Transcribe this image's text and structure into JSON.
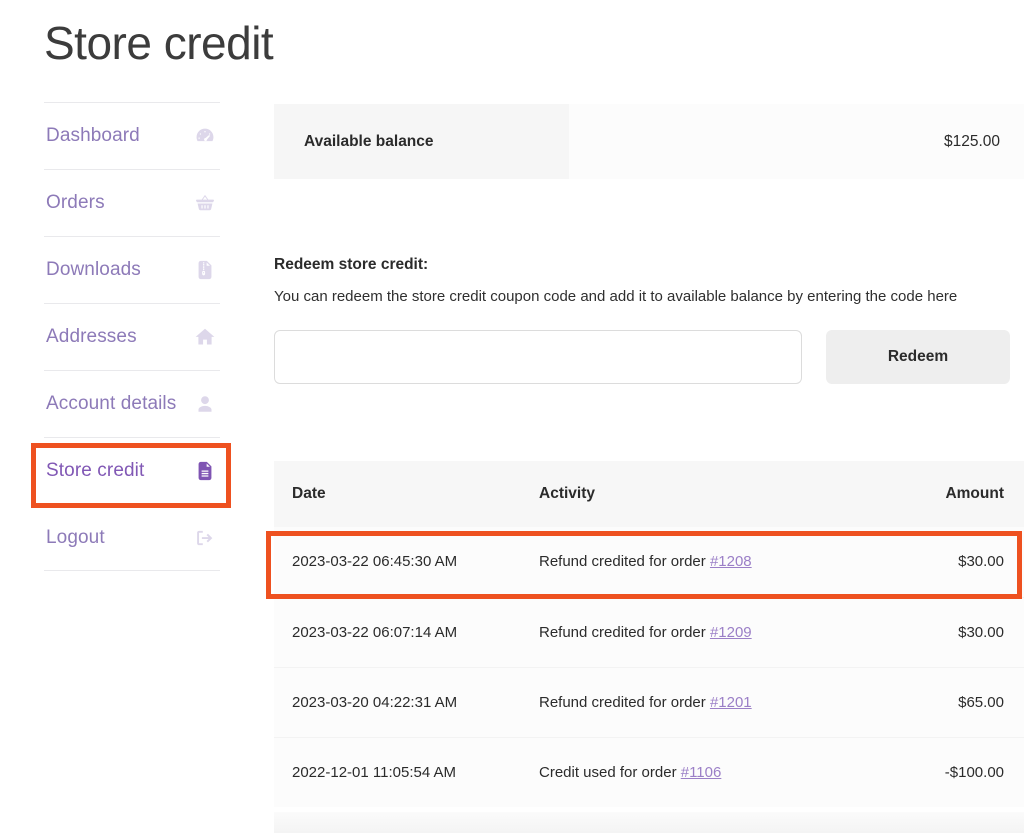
{
  "page": {
    "title": "Store credit"
  },
  "sidebar": {
    "items": [
      {
        "label": "Dashboard",
        "icon": "gauge-icon",
        "active": false
      },
      {
        "label": "Orders",
        "icon": "basket-icon",
        "active": false
      },
      {
        "label": "Downloads",
        "icon": "download-file-icon",
        "active": false
      },
      {
        "label": "Addresses",
        "icon": "home-icon",
        "active": false
      },
      {
        "label": "Account details",
        "icon": "user-icon",
        "active": false
      },
      {
        "label": "Store credit",
        "icon": "document-icon",
        "active": true
      },
      {
        "label": "Logout",
        "icon": "logout-icon",
        "active": false
      }
    ]
  },
  "balance": {
    "label": "Available balance",
    "value": "$125.00"
  },
  "redeem": {
    "heading": "Redeem store credit:",
    "description": "You can redeem the store credit coupon code and add it to available balance by entering the code here",
    "input_value": "",
    "input_placeholder": "",
    "button_label": "Redeem"
  },
  "activity": {
    "columns": [
      "Date",
      "Activity",
      "Amount"
    ],
    "rows": [
      {
        "date": "2023-03-22 06:45:30 AM",
        "activity_prefix": "Refund credited for order ",
        "order_link": "#1208",
        "amount": "$30.00",
        "highlighted": true
      },
      {
        "date": "2023-03-22 06:07:14 AM",
        "activity_prefix": "Refund credited for order ",
        "order_link": "#1209",
        "amount": "$30.00",
        "highlighted": false
      },
      {
        "date": "2023-03-20 04:22:31 AM",
        "activity_prefix": "Refund credited for order ",
        "order_link": "#1201",
        "amount": "$65.00",
        "highlighted": false
      },
      {
        "date": "2022-12-01 11:05:54 AM",
        "activity_prefix": "Credit used for order ",
        "order_link": "#1106",
        "amount": "-$100.00",
        "highlighted": false
      }
    ]
  },
  "colors": {
    "accent_purple": "#7f54b3",
    "link_purple": "#9b7fc7",
    "nav_purple": "#8d7ab8",
    "nav_icon_light": "#ddd7ea",
    "annotation_orange": "#ee5120",
    "panel_gray": "#f6f6f6"
  }
}
